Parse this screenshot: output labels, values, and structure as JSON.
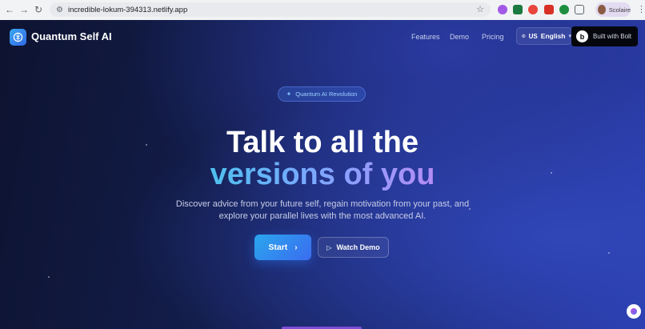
{
  "browser": {
    "url": "incredible-lokum-394313.netlify.app",
    "profile_name": "Scolaire",
    "extension_colors": [
      "#a259e6",
      "#1b7a3f",
      "#e8453c",
      "#d93025",
      "#1e8e3e",
      "#5f6368"
    ]
  },
  "header": {
    "brand": "Quantum Self AI",
    "nav": [
      "Features",
      "Demo",
      "Pricing"
    ],
    "language": {
      "code": "US",
      "name": "English"
    },
    "bolt_badge": "Built with Bolt"
  },
  "hero": {
    "badge": "Quantum AI Revolution",
    "title_line1": "Talk to all the",
    "title_line2": "versions of you",
    "subtitle_line1": "Discover advice from your future self, regain motivation from your past, and",
    "subtitle_line2": "explore your parallel lives with the most advanced AI.",
    "start_label": "Start",
    "demo_label": "Watch Demo"
  },
  "colors": {
    "accent_gradient_start": "#2aa6ee",
    "accent_gradient_end": "#3b6cf0",
    "title_gradient": [
      "#4fc0ee",
      "#7aa8ff",
      "#b48cf5"
    ]
  },
  "icons": {
    "back": "arrow-left-icon",
    "forward": "arrow-right-icon",
    "reload": "reload-icon",
    "site_settings": "tune-icon",
    "bookmark": "star-icon",
    "logo": "brain-icon",
    "language": "globe-icon",
    "badge": "sparkle-icon",
    "start": "chevron-right-icon",
    "demo": "play-icon"
  }
}
